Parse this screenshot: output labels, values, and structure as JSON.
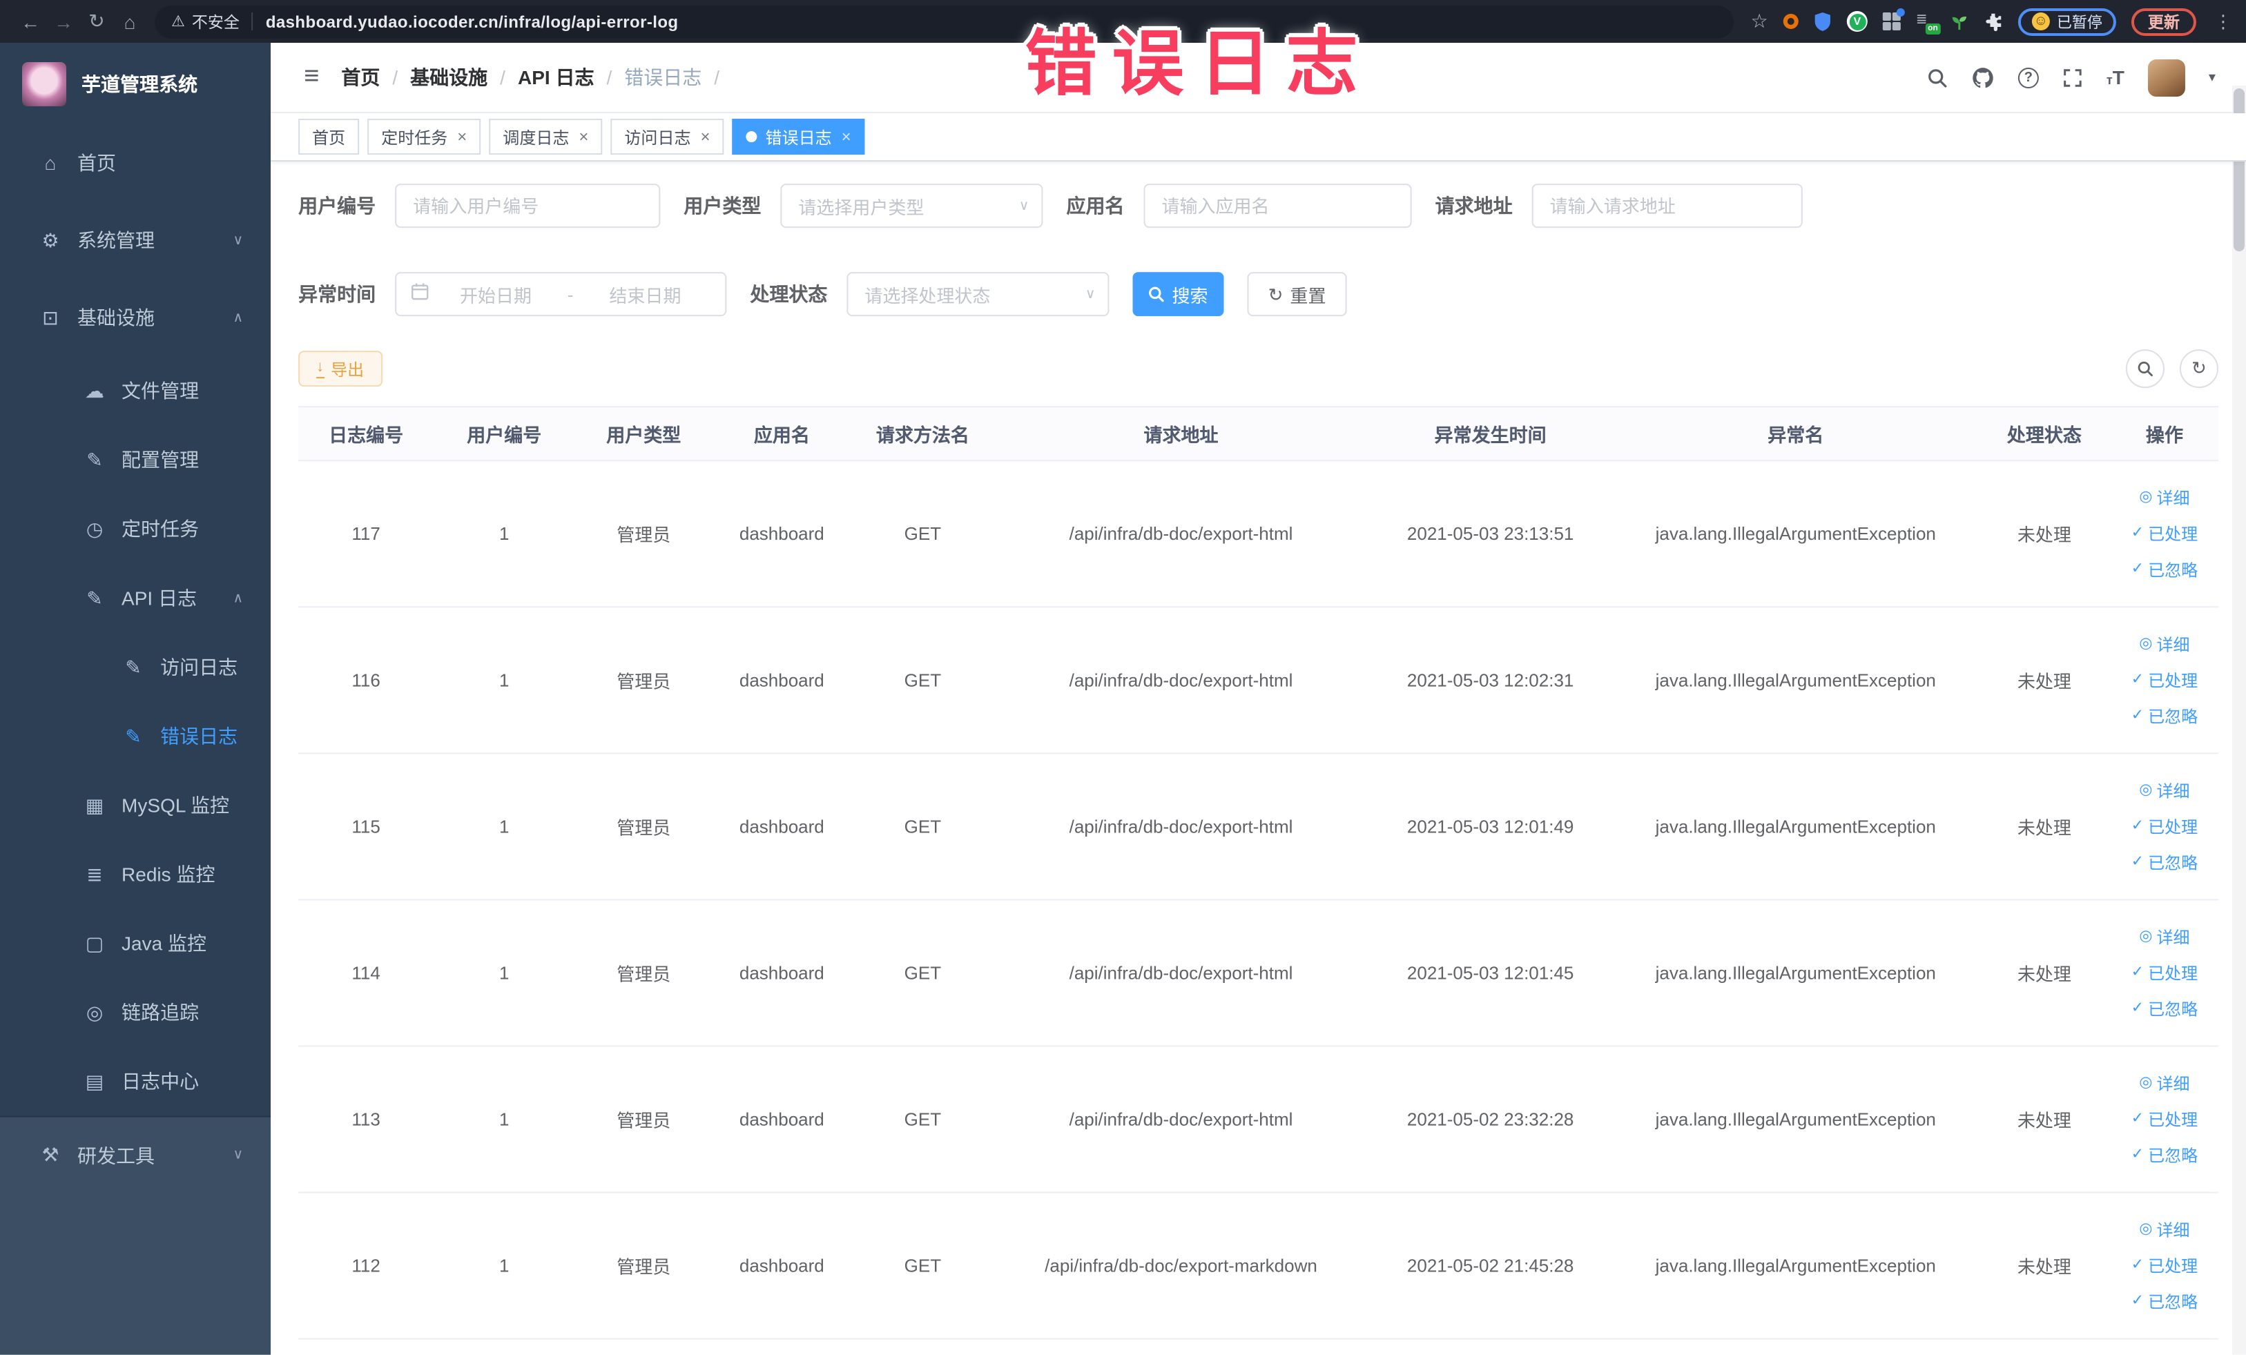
{
  "colors": {
    "primary": "#409eff",
    "sidebar_bg": "#2d3f55",
    "sidebar_lower_bg": "#3c4e63",
    "annotation_red": "#f73e5e",
    "export_text": "#e6a23c",
    "export_bg": "#fdf6ec"
  },
  "annotation": {
    "text": "错误日志"
  },
  "browser": {
    "security_label": "不安全",
    "url": "dashboard.yudao.iocoder.cn/infra/log/api-error-log",
    "paused_label": "已暂停",
    "update_label": "更新",
    "on_badge": "on"
  },
  "sidebar": {
    "app_title": "芋道管理系统",
    "items": [
      {
        "label": "首页",
        "icon": "⌂",
        "icon_name": "home-icon",
        "cls": "lvl0"
      },
      {
        "label": "系统管理",
        "icon": "⚙",
        "icon_name": "gear-icon",
        "cls": "lvl0",
        "chevron": "∨"
      },
      {
        "label": "基础设施",
        "icon": "⊡",
        "icon_name": "infrastructure-icon",
        "cls": "lvl0",
        "chevron": "∧"
      },
      {
        "label": "文件管理",
        "icon": "☁",
        "icon_name": "cloud-upload-icon",
        "cls": "lvl1"
      },
      {
        "label": "配置管理",
        "icon": "✎",
        "icon_name": "edit-config-icon",
        "cls": "lvl1"
      },
      {
        "label": "定时任务",
        "icon": "◷",
        "icon_name": "timer-icon",
        "cls": "lvl1"
      },
      {
        "label": "API 日志",
        "icon": "✎",
        "icon_name": "api-log-icon",
        "cls": "lvl1",
        "chevron": "∧"
      },
      {
        "label": "访问日志",
        "icon": "✎",
        "icon_name": "access-log-icon",
        "cls": "lvl2"
      },
      {
        "label": "错误日志",
        "icon": "✎",
        "icon_name": "error-log-icon",
        "cls": "lvl2 active"
      },
      {
        "label": "MySQL 监控",
        "icon": "▦",
        "icon_name": "mysql-monitor-icon",
        "cls": "lvl1"
      },
      {
        "label": "Redis 监控",
        "icon": "≣",
        "icon_name": "redis-monitor-icon",
        "cls": "lvl1"
      },
      {
        "label": "Java 监控",
        "icon": "▢",
        "icon_name": "java-monitor-icon",
        "cls": "lvl1"
      },
      {
        "label": "链路追踪",
        "icon": "◎",
        "icon_name": "trace-eye-icon",
        "cls": "lvl1"
      },
      {
        "label": "日志中心",
        "icon": "▤",
        "icon_name": "log-center-icon",
        "cls": "lvl1"
      },
      {
        "label": "研发工具",
        "icon": "⚒",
        "icon_name": "devtools-icon",
        "cls": "lvl0 lower",
        "chevron": "∨"
      }
    ]
  },
  "header": {
    "breadcrumb": [
      {
        "label": "首页",
        "cls": ""
      },
      {
        "label": "基础设施",
        "cls": ""
      },
      {
        "label": "API 日志",
        "cls": ""
      },
      {
        "label": "错误日志",
        "cls": "current"
      }
    ]
  },
  "tabs": [
    {
      "label": "首页",
      "cls": ""
    },
    {
      "label": "定时任务",
      "cls": "",
      "closable": true
    },
    {
      "label": "调度日志",
      "cls": "",
      "closable": true
    },
    {
      "label": "访问日志",
      "cls": "",
      "closable": true
    },
    {
      "label": "错误日志",
      "cls": "active",
      "closable": true
    }
  ],
  "filters": {
    "user_id": {
      "label": "用户编号",
      "placeholder": "请输入用户编号"
    },
    "user_type": {
      "label": "用户类型",
      "placeholder": "请选择用户类型"
    },
    "app_name": {
      "label": "应用名",
      "placeholder": "请输入应用名"
    },
    "req_url": {
      "label": "请求地址",
      "placeholder": "请输入请求地址"
    },
    "time": {
      "label": "异常时间",
      "start_placeholder": "开始日期",
      "separator": "-",
      "end_placeholder": "结束日期"
    },
    "status": {
      "label": "处理状态",
      "placeholder": "请选择处理状态"
    },
    "search_label": "搜索",
    "reset_label": "重置"
  },
  "toolbar": {
    "export_label": "导出"
  },
  "table": {
    "columns": [
      {
        "label": "日志编号"
      },
      {
        "label": "用户编号"
      },
      {
        "label": "用户类型"
      },
      {
        "label": "应用名"
      },
      {
        "label": "请求方法名"
      },
      {
        "label": "请求地址"
      },
      {
        "label": "异常发生时间"
      },
      {
        "label": "异常名"
      },
      {
        "label": "处理状态"
      },
      {
        "label": "操作"
      }
    ],
    "rows": [
      {
        "id": "117",
        "user_id": "1",
        "user_type": "管理员",
        "app": "dashboard",
        "method": "GET",
        "url": "/api/infra/db-doc/export-html",
        "time": "2021-05-03 23:13:51",
        "exception": "java.lang.IllegalArgumentException",
        "status": "未处理",
        "actions": [
          "详细",
          "已处理",
          "已忽略"
        ]
      },
      {
        "id": "116",
        "user_id": "1",
        "user_type": "管理员",
        "app": "dashboard",
        "method": "GET",
        "url": "/api/infra/db-doc/export-html",
        "time": "2021-05-03 12:02:31",
        "exception": "java.lang.IllegalArgumentException",
        "status": "未处理",
        "actions": [
          "详细",
          "已处理",
          "已忽略"
        ]
      },
      {
        "id": "115",
        "user_id": "1",
        "user_type": "管理员",
        "app": "dashboard",
        "method": "GET",
        "url": "/api/infra/db-doc/export-html",
        "time": "2021-05-03 12:01:49",
        "exception": "java.lang.IllegalArgumentException",
        "status": "未处理",
        "actions": [
          "详细",
          "已处理",
          "已忽略"
        ]
      },
      {
        "id": "114",
        "user_id": "1",
        "user_type": "管理员",
        "app": "dashboard",
        "method": "GET",
        "url": "/api/infra/db-doc/export-html",
        "time": "2021-05-03 12:01:45",
        "exception": "java.lang.IllegalArgumentException",
        "status": "未处理",
        "actions": [
          "详细",
          "已处理",
          "已忽略"
        ]
      },
      {
        "id": "113",
        "user_id": "1",
        "user_type": "管理员",
        "app": "dashboard",
        "method": "GET",
        "url": "/api/infra/db-doc/export-html",
        "time": "2021-05-02 23:32:28",
        "exception": "java.lang.IllegalArgumentException",
        "status": "未处理",
        "actions": [
          "详细",
          "已处理",
          "已忽略"
        ]
      },
      {
        "id": "112",
        "user_id": "1",
        "user_type": "管理员",
        "app": "dashboard",
        "method": "GET",
        "url": "/api/infra/db-doc/export-markdown",
        "time": "2021-05-02 21:45:28",
        "exception": "java.lang.IllegalArgumentException",
        "status": "未处理",
        "actions": [
          "详细",
          "已处理",
          "已忽略"
        ]
      }
    ]
  }
}
